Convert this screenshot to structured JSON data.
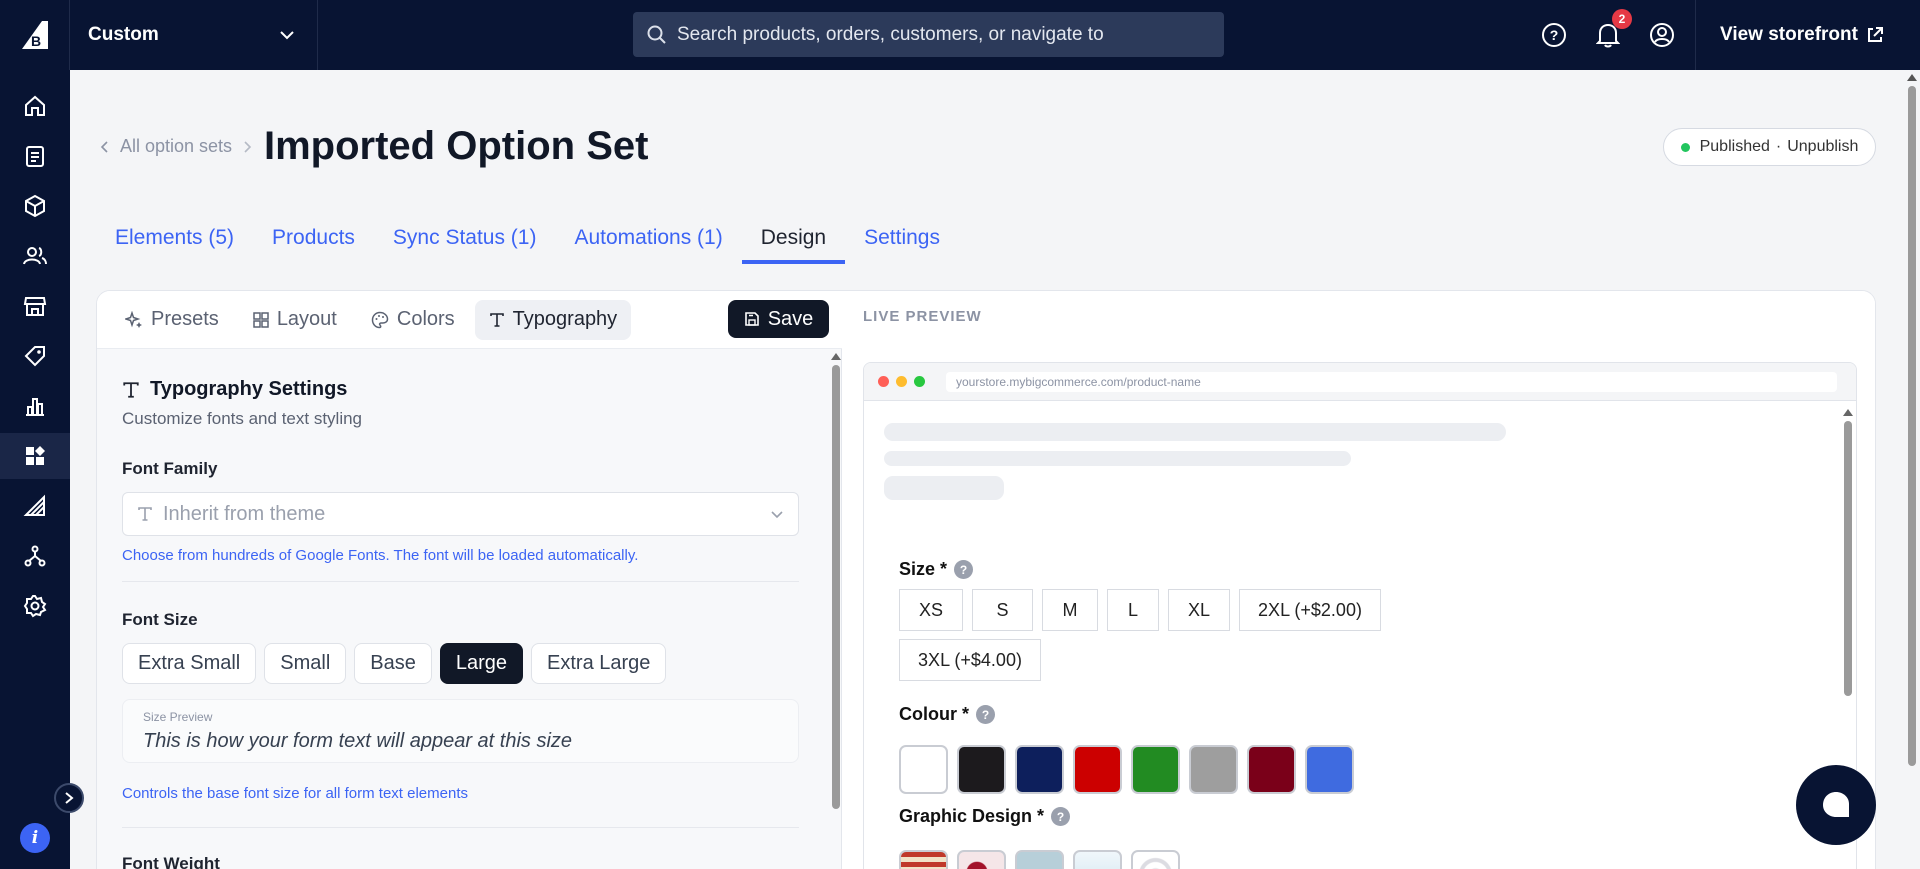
{
  "topbar": {
    "store_name": "Custom",
    "search_placeholder": "Search products, orders, customers, or navigate to",
    "notification_count": "2",
    "view_storefront": "View storefront"
  },
  "sidebar": {
    "items": [
      "home-icon",
      "orders-icon",
      "products-icon",
      "customers-icon",
      "storefront-icon",
      "marketing-icon",
      "analytics-icon",
      "apps-icon",
      "channels-icon",
      "integrations-icon",
      "settings-icon"
    ],
    "active_index": 7
  },
  "header": {
    "breadcrumb": "All option sets",
    "title": "Imported Option Set",
    "status": "Published",
    "status_sep": "·",
    "unpublish": "Unpublish"
  },
  "tabs": [
    {
      "label": "Elements (5)"
    },
    {
      "label": "Products"
    },
    {
      "label": "Sync Status (1)"
    },
    {
      "label": "Automations (1)"
    },
    {
      "label": "Design",
      "active": true
    },
    {
      "label": "Settings"
    }
  ],
  "design": {
    "subtabs": [
      "Presets",
      "Layout",
      "Colors",
      "Typography"
    ],
    "active_subtab": "Typography",
    "save_label": "Save",
    "section_title": "Typography Settings",
    "section_subtitle": "Customize fonts and text styling",
    "font_family_label": "Font Family",
    "font_family_placeholder": "Inherit from theme",
    "font_family_hint": "Choose from hundreds of Google Fonts. The font will be loaded automatically.",
    "font_size_label": "Font Size",
    "font_sizes": [
      "Extra Small",
      "Small",
      "Base",
      "Large",
      "Extra Large"
    ],
    "font_size_selected": "Large",
    "size_preview_label": "Size Preview",
    "size_preview_text": "This is how your form text will appear at this size",
    "font_size_hint": "Controls the base font size for all form text elements",
    "font_weight_label": "Font Weight"
  },
  "preview": {
    "label": "LIVE PREVIEW",
    "url": "yourstore.mybigcommerce.com/product-name",
    "size_label": "Size",
    "required_mark": "*",
    "help_mark": "?",
    "sizes_row1": [
      "XS",
      "S",
      "M",
      "L",
      "XL",
      "2XL (+$2.00)"
    ],
    "sizes_row2": [
      "3XL (+$4.00)"
    ],
    "colour_label": "Colour",
    "colours": [
      "#ffffff",
      "#1c1a1d",
      "#0d1f5c",
      "#cc0000",
      "#228b22",
      "#9e9e9e",
      "#7a0019",
      "#3f6be0"
    ],
    "graphic_label": "Graphic Design"
  },
  "colors": {
    "accent": "#3c64f4",
    "nav_bg": "#081433",
    "dark_btn": "#111827"
  }
}
